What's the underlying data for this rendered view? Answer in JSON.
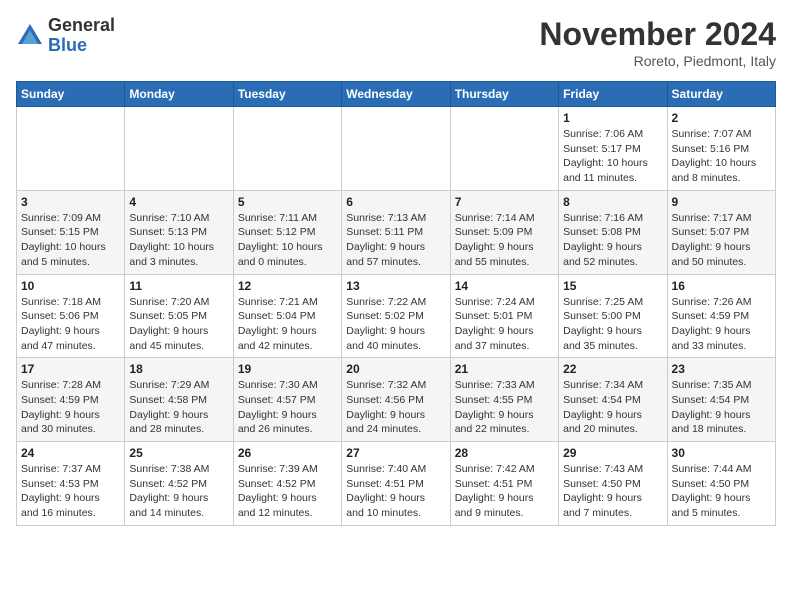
{
  "header": {
    "logo_general": "General",
    "logo_blue": "Blue",
    "month_title": "November 2024",
    "location": "Roreto, Piedmont, Italy"
  },
  "weekdays": [
    "Sunday",
    "Monday",
    "Tuesday",
    "Wednesday",
    "Thursday",
    "Friday",
    "Saturday"
  ],
  "weeks": [
    [
      {
        "day": "",
        "info": ""
      },
      {
        "day": "",
        "info": ""
      },
      {
        "day": "",
        "info": ""
      },
      {
        "day": "",
        "info": ""
      },
      {
        "day": "",
        "info": ""
      },
      {
        "day": "1",
        "info": "Sunrise: 7:06 AM\nSunset: 5:17 PM\nDaylight: 10 hours\nand 11 minutes."
      },
      {
        "day": "2",
        "info": "Sunrise: 7:07 AM\nSunset: 5:16 PM\nDaylight: 10 hours\nand 8 minutes."
      }
    ],
    [
      {
        "day": "3",
        "info": "Sunrise: 7:09 AM\nSunset: 5:15 PM\nDaylight: 10 hours\nand 5 minutes."
      },
      {
        "day": "4",
        "info": "Sunrise: 7:10 AM\nSunset: 5:13 PM\nDaylight: 10 hours\nand 3 minutes."
      },
      {
        "day": "5",
        "info": "Sunrise: 7:11 AM\nSunset: 5:12 PM\nDaylight: 10 hours\nand 0 minutes."
      },
      {
        "day": "6",
        "info": "Sunrise: 7:13 AM\nSunset: 5:11 PM\nDaylight: 9 hours\nand 57 minutes."
      },
      {
        "day": "7",
        "info": "Sunrise: 7:14 AM\nSunset: 5:09 PM\nDaylight: 9 hours\nand 55 minutes."
      },
      {
        "day": "8",
        "info": "Sunrise: 7:16 AM\nSunset: 5:08 PM\nDaylight: 9 hours\nand 52 minutes."
      },
      {
        "day": "9",
        "info": "Sunrise: 7:17 AM\nSunset: 5:07 PM\nDaylight: 9 hours\nand 50 minutes."
      }
    ],
    [
      {
        "day": "10",
        "info": "Sunrise: 7:18 AM\nSunset: 5:06 PM\nDaylight: 9 hours\nand 47 minutes."
      },
      {
        "day": "11",
        "info": "Sunrise: 7:20 AM\nSunset: 5:05 PM\nDaylight: 9 hours\nand 45 minutes."
      },
      {
        "day": "12",
        "info": "Sunrise: 7:21 AM\nSunset: 5:04 PM\nDaylight: 9 hours\nand 42 minutes."
      },
      {
        "day": "13",
        "info": "Sunrise: 7:22 AM\nSunset: 5:02 PM\nDaylight: 9 hours\nand 40 minutes."
      },
      {
        "day": "14",
        "info": "Sunrise: 7:24 AM\nSunset: 5:01 PM\nDaylight: 9 hours\nand 37 minutes."
      },
      {
        "day": "15",
        "info": "Sunrise: 7:25 AM\nSunset: 5:00 PM\nDaylight: 9 hours\nand 35 minutes."
      },
      {
        "day": "16",
        "info": "Sunrise: 7:26 AM\nSunset: 4:59 PM\nDaylight: 9 hours\nand 33 minutes."
      }
    ],
    [
      {
        "day": "17",
        "info": "Sunrise: 7:28 AM\nSunset: 4:59 PM\nDaylight: 9 hours\nand 30 minutes."
      },
      {
        "day": "18",
        "info": "Sunrise: 7:29 AM\nSunset: 4:58 PM\nDaylight: 9 hours\nand 28 minutes."
      },
      {
        "day": "19",
        "info": "Sunrise: 7:30 AM\nSunset: 4:57 PM\nDaylight: 9 hours\nand 26 minutes."
      },
      {
        "day": "20",
        "info": "Sunrise: 7:32 AM\nSunset: 4:56 PM\nDaylight: 9 hours\nand 24 minutes."
      },
      {
        "day": "21",
        "info": "Sunrise: 7:33 AM\nSunset: 4:55 PM\nDaylight: 9 hours\nand 22 minutes."
      },
      {
        "day": "22",
        "info": "Sunrise: 7:34 AM\nSunset: 4:54 PM\nDaylight: 9 hours\nand 20 minutes."
      },
      {
        "day": "23",
        "info": "Sunrise: 7:35 AM\nSunset: 4:54 PM\nDaylight: 9 hours\nand 18 minutes."
      }
    ],
    [
      {
        "day": "24",
        "info": "Sunrise: 7:37 AM\nSunset: 4:53 PM\nDaylight: 9 hours\nand 16 minutes."
      },
      {
        "day": "25",
        "info": "Sunrise: 7:38 AM\nSunset: 4:52 PM\nDaylight: 9 hours\nand 14 minutes."
      },
      {
        "day": "26",
        "info": "Sunrise: 7:39 AM\nSunset: 4:52 PM\nDaylight: 9 hours\nand 12 minutes."
      },
      {
        "day": "27",
        "info": "Sunrise: 7:40 AM\nSunset: 4:51 PM\nDaylight: 9 hours\nand 10 minutes."
      },
      {
        "day": "28",
        "info": "Sunrise: 7:42 AM\nSunset: 4:51 PM\nDaylight: 9 hours\nand 9 minutes."
      },
      {
        "day": "29",
        "info": "Sunrise: 7:43 AM\nSunset: 4:50 PM\nDaylight: 9 hours\nand 7 minutes."
      },
      {
        "day": "30",
        "info": "Sunrise: 7:44 AM\nSunset: 4:50 PM\nDaylight: 9 hours\nand 5 minutes."
      }
    ]
  ]
}
